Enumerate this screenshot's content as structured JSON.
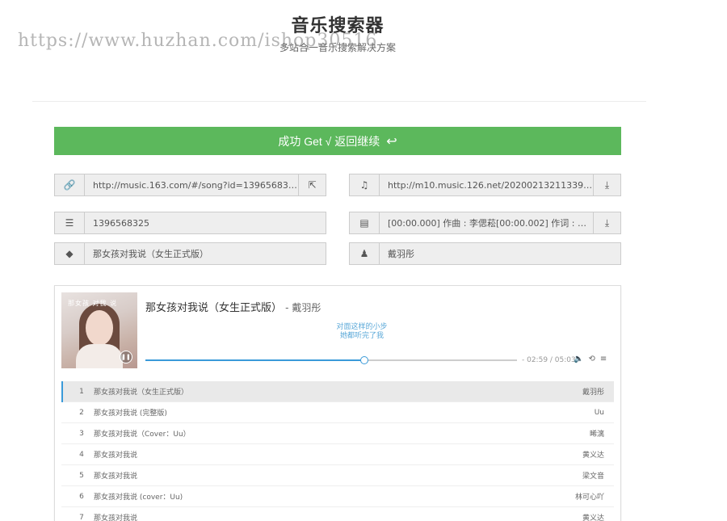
{
  "header": {
    "title": "音乐搜索器",
    "subtitle": "多站合一音乐搜索解决方案",
    "watermark": "https://www.huzhan.com/ishop30516"
  },
  "success_button": {
    "label": "成功 Get √ 返回继续",
    "icon": "reply-icon"
  },
  "fields": {
    "link": {
      "icon": "link-icon",
      "value": "http://music.163.com/#/song?id=1396568325",
      "action_icon": "external-link-icon"
    },
    "music_url": {
      "icon": "music-icon",
      "value": "http://m10.music.126.net/20200213211339/705...",
      "action_icon": "download-icon"
    },
    "song_id": {
      "icon": "list-icon",
      "value": "1396568325"
    },
    "lyrics": {
      "icon": "file-icon",
      "value": "[00:00.000] 作曲 : 李偲菘[00:00.002] 作词 : 易家...",
      "action_icon": "download-icon"
    },
    "song_name": {
      "icon": "tag-icon",
      "value": "那女孩对我说（女生正式版）"
    },
    "artist": {
      "icon": "user-icon",
      "value": "戴羽彤"
    }
  },
  "player": {
    "title": "那女孩对我说（女生正式版）",
    "artist": "戴羽彤",
    "lyric_line1": "对面这样的小步",
    "lyric_line2": "她都听完了我",
    "time": "- 02:59 / 05:03",
    "progress": 0.59,
    "cover_text": "那女孩 对我 说"
  },
  "playlist": [
    {
      "idx": "1",
      "name": "那女孩对我说（女生正式版）",
      "artist": "戴羽彤",
      "active": true
    },
    {
      "idx": "2",
      "name": "那女孩对我说 (完整版)",
      "artist": "Uu"
    },
    {
      "idx": "3",
      "name": "那女孩对我说（Cover：Uu）",
      "artist": "晞漓"
    },
    {
      "idx": "4",
      "name": "那女孩对我说",
      "artist": "黄义达"
    },
    {
      "idx": "5",
      "name": "那女孩对我说",
      "artist": "梁文音"
    },
    {
      "idx": "6",
      "name": "那女孩对我说 (cover：Uu)",
      "artist": "林可心吖"
    },
    {
      "idx": "7",
      "name": "那女孩对我说",
      "artist": "黄义达"
    }
  ],
  "colors": {
    "success": "#5cb85c",
    "accent": "#3a9ad9"
  }
}
